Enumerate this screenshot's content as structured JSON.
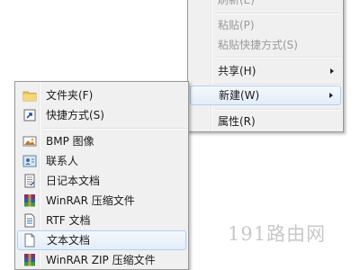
{
  "context_menu": {
    "items": [
      {
        "label": "刷新(E)"
      },
      {
        "label": "粘贴(P)"
      },
      {
        "label": "粘贴快捷方式(S)"
      },
      {
        "label": "共享(H)"
      },
      {
        "label": "新建(W)"
      },
      {
        "label": "属性(R)"
      }
    ]
  },
  "new_submenu": {
    "items": [
      {
        "label": "文件夹(F)",
        "icon": "folder-icon"
      },
      {
        "label": "快捷方式(S)",
        "icon": "shortcut-icon"
      },
      {
        "label": "BMP 图像",
        "icon": "bmp-image-icon"
      },
      {
        "label": "联系人",
        "icon": "contact-icon"
      },
      {
        "label": "日记本文档",
        "icon": "journal-icon"
      },
      {
        "label": "WinRAR 压缩文件",
        "icon": "winrar-icon"
      },
      {
        "label": "RTF 文档",
        "icon": "rtf-icon"
      },
      {
        "label": "文本文档",
        "icon": "text-document-icon"
      },
      {
        "label": "WinRAR ZIP 压缩文件",
        "icon": "winrar-zip-icon"
      }
    ]
  },
  "watermark": "191路由网",
  "colors": {
    "menu_background": "#f0f0f0",
    "hover_background": "#e3edf8",
    "hover_border": "#aecff7",
    "disabled_text": "#9a9a9a"
  }
}
